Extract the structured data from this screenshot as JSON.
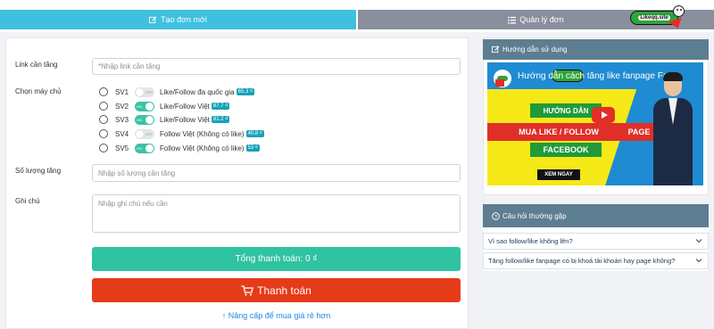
{
  "tabs": {
    "new_order": "Tạo đơn mới",
    "manage": "Quản lý đơn"
  },
  "logo": {
    "text": "Likeqq.site"
  },
  "form": {
    "link_label": "Link cần tăng",
    "link_placeholder": "*Nhập link cần tăng",
    "server_label": "Chọn máy chủ",
    "servers": [
      {
        "id": "SV1",
        "toggle": "OFF",
        "desc": "Like/Follow đa quốc gia",
        "price": "65.3 ₫"
      },
      {
        "id": "SV2",
        "toggle": "ON",
        "desc": "Like/Follow Việt",
        "price": "87.7 ₫"
      },
      {
        "id": "SV3",
        "toggle": "ON",
        "desc": "Like/Follow Việt",
        "price": "81.2 ₫"
      },
      {
        "id": "SV4",
        "toggle": "OFF",
        "desc": "Follow Việt (Không có like)",
        "price": "40.8 ₫"
      },
      {
        "id": "SV5",
        "toggle": "ON",
        "desc": "Follow Việt (Không có like)",
        "price": "53 ₫"
      }
    ],
    "quantity_label": "Số lượng tăng",
    "quantity_placeholder": "Nhập số lượng cần tăng",
    "note_label": "Ghi chú",
    "note_placeholder": "Nhập ghi chú nếu cần",
    "total": "Tổng thanh toán: 0 ₫",
    "pay": "Thanh toán",
    "upgrade": "Nâng cấp để mua giá rẻ hơn"
  },
  "guide": {
    "title": "Hướng dẫn sử dụng",
    "video_title": "Hướng dẫn cách tăng like fanpage Fa...",
    "video_huong": "HƯỚNG DẪN",
    "video_mua": "MUA LIKE / FOLLOW",
    "video_page": "PAGE",
    "video_fb": "FACEBOOK",
    "video_xem": "XEM NGAY"
  },
  "faq": {
    "title": "Câu hỏi thường gặp",
    "items": [
      "Vì sao follow/like không lên?",
      "Tăng follow/like fanpage có bị khoá tài khoản hay page không?"
    ]
  },
  "colors": {
    "tab_active": "#3ec0de",
    "tab_inactive": "#8a8f9e",
    "total_button": "#2fc3a1",
    "pay_button": "#e53b18",
    "panel_header": "#5d7e90",
    "price_badge": "#18a2b8"
  }
}
